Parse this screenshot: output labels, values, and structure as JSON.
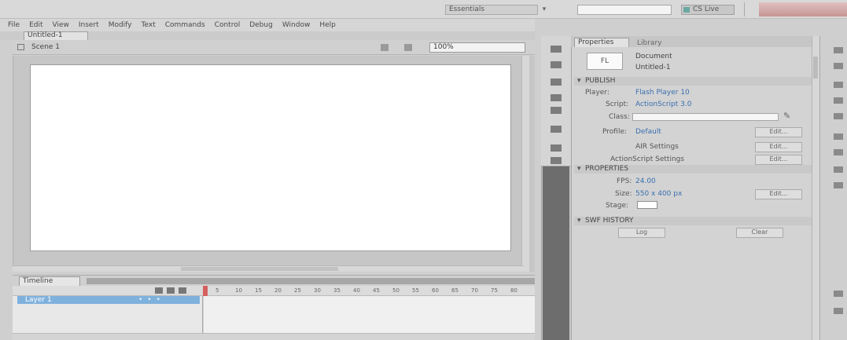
{
  "titlebar": {
    "workspace": "Essentials",
    "search_placeholder": "",
    "cs_live": "CS Live"
  },
  "menu": [
    "File",
    "Edit",
    "View",
    "Insert",
    "Modify",
    "Text",
    "Commands",
    "Control",
    "Debug",
    "Window",
    "Help"
  ],
  "document": {
    "tab_label": "Untitled-1",
    "scene_label": "Scene 1",
    "zoom": "100%"
  },
  "timeline": {
    "tab_label": "Timeline",
    "layer_name": "Layer 1",
    "frame_numbers": [
      "5",
      "10",
      "15",
      "20",
      "25",
      "30",
      "35",
      "40",
      "45",
      "50",
      "55",
      "60",
      "65",
      "70",
      "75",
      "80"
    ]
  },
  "properties": {
    "tab_label": "Properties",
    "library_tab": "Library",
    "doc_thumb": "FL",
    "doc_type": "Document",
    "doc_name": "Untitled-1",
    "publish_header": "PUBLISH",
    "player_label": "Player:",
    "player_value": "Flash Player 10",
    "script_label": "Script:",
    "script_value": "ActionScript 3.0",
    "class_label": "Class:",
    "profile_label": "Profile:",
    "profile_value": "Default",
    "profile_btn": "Edit...",
    "air_label": "AIR Settings",
    "air_btn": "Edit...",
    "as_settings_label": "ActionScript Settings",
    "as_settings_btn": "Edit...",
    "properties_header": "PROPERTIES",
    "fps_label": "FPS:",
    "fps_value": "24.00",
    "size_label": "Size:",
    "size_value": "550 x 400 px",
    "size_btn": "Edit...",
    "stage_label": "Stage:",
    "swf_history_header": "SWF HISTORY",
    "log_btn": "Log",
    "clear_btn": "Clear"
  },
  "colors": {
    "stage": "#ffffff",
    "layer_highlight": "#7fb1dd",
    "playhead": "#d66060",
    "value_blue": "#3a6fb0"
  }
}
